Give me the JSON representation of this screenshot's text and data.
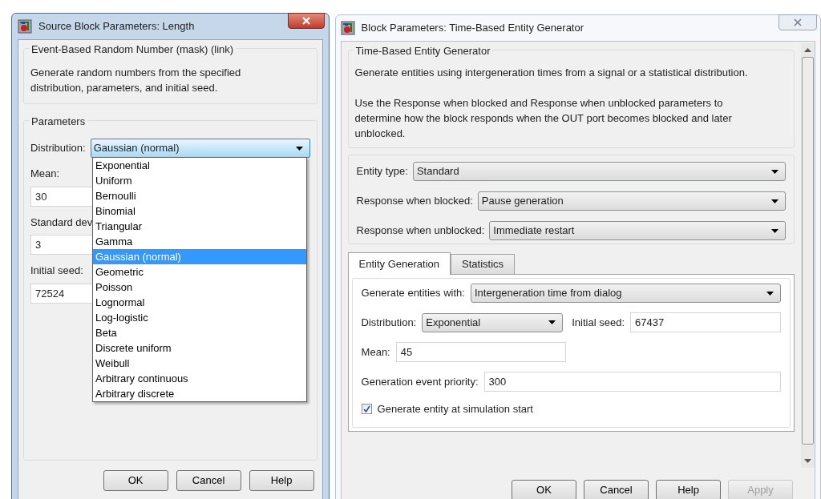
{
  "left_window": {
    "title": "Source Block Parameters: Length",
    "group_title": "Event-Based Random Number (mask) (link)",
    "description": "Generate random numbers from the specified distribution, parameters, and initial seed.",
    "parameters_title": "Parameters",
    "distribution": {
      "label": "Distribution:",
      "value": "Gaussian (normal)",
      "expanded": true,
      "options": [
        {
          "label": "Exponential",
          "selected": false
        },
        {
          "label": "Uniform",
          "selected": false
        },
        {
          "label": "Bernoulli",
          "selected": false
        },
        {
          "label": "Binomial",
          "selected": false
        },
        {
          "label": "Triangular",
          "selected": false
        },
        {
          "label": "Gamma",
          "selected": false
        },
        {
          "label": "Gaussian (normal)",
          "selected": true
        },
        {
          "label": "Geometric",
          "selected": false
        },
        {
          "label": "Poisson",
          "selected": false
        },
        {
          "label": "Lognormal",
          "selected": false
        },
        {
          "label": "Log-logistic",
          "selected": false
        },
        {
          "label": "Beta",
          "selected": false
        },
        {
          "label": "Discrete uniform",
          "selected": false
        },
        {
          "label": "Weibull",
          "selected": false
        },
        {
          "label": "Arbitrary continuous",
          "selected": false
        },
        {
          "label": "Arbitrary discrete",
          "selected": false
        }
      ]
    },
    "fields": [
      {
        "label": "Mean:",
        "value": "30"
      },
      {
        "label": "Standard dev",
        "value": "3"
      },
      {
        "label": "Initial seed:",
        "value": "72524"
      }
    ],
    "buttons": [
      {
        "label": "OK",
        "disabled": false
      },
      {
        "label": "Cancel",
        "disabled": false
      },
      {
        "label": "Help",
        "disabled": false
      }
    ]
  },
  "right_window": {
    "title": "Block Parameters: Time-Based Entity Generator",
    "group_title": "Time-Based Entity Generator",
    "paragraphs": [
      "Generate entities using intergeneration times from a signal or a statistical distribution.",
      "Use the Response when blocked and Response when unblocked parameters to determine how the block responds when the OUT port becomes blocked and later unblocked."
    ],
    "dropdowns": [
      {
        "label": "Entity type:",
        "value": "Standard"
      },
      {
        "label": "Response when blocked:",
        "value": "Pause generation"
      },
      {
        "label": "Response when unblocked:",
        "value": "Immediate restart"
      }
    ],
    "tabs": [
      {
        "label": "Entity Generation",
        "selected": true
      },
      {
        "label": "Statistics",
        "selected": false
      }
    ],
    "generate_with": {
      "label": "Generate entities with:",
      "value": "Intergeneration time from dialog"
    },
    "distribution": {
      "label": "Distribution:",
      "value": "Exponential"
    },
    "initial_seed": {
      "label": "Initial seed:",
      "value": "67437"
    },
    "mean": {
      "label": "Mean:",
      "value": "45"
    },
    "priority": {
      "label": "Generation event priority:",
      "value": "300"
    },
    "start_checkbox": {
      "label": "Generate entity at simulation start",
      "checked": true
    },
    "buttons": [
      {
        "label": "OK",
        "disabled": false
      },
      {
        "label": "Cancel",
        "disabled": false
      },
      {
        "label": "Help",
        "disabled": false
      },
      {
        "label": "Apply",
        "disabled": true
      }
    ]
  }
}
